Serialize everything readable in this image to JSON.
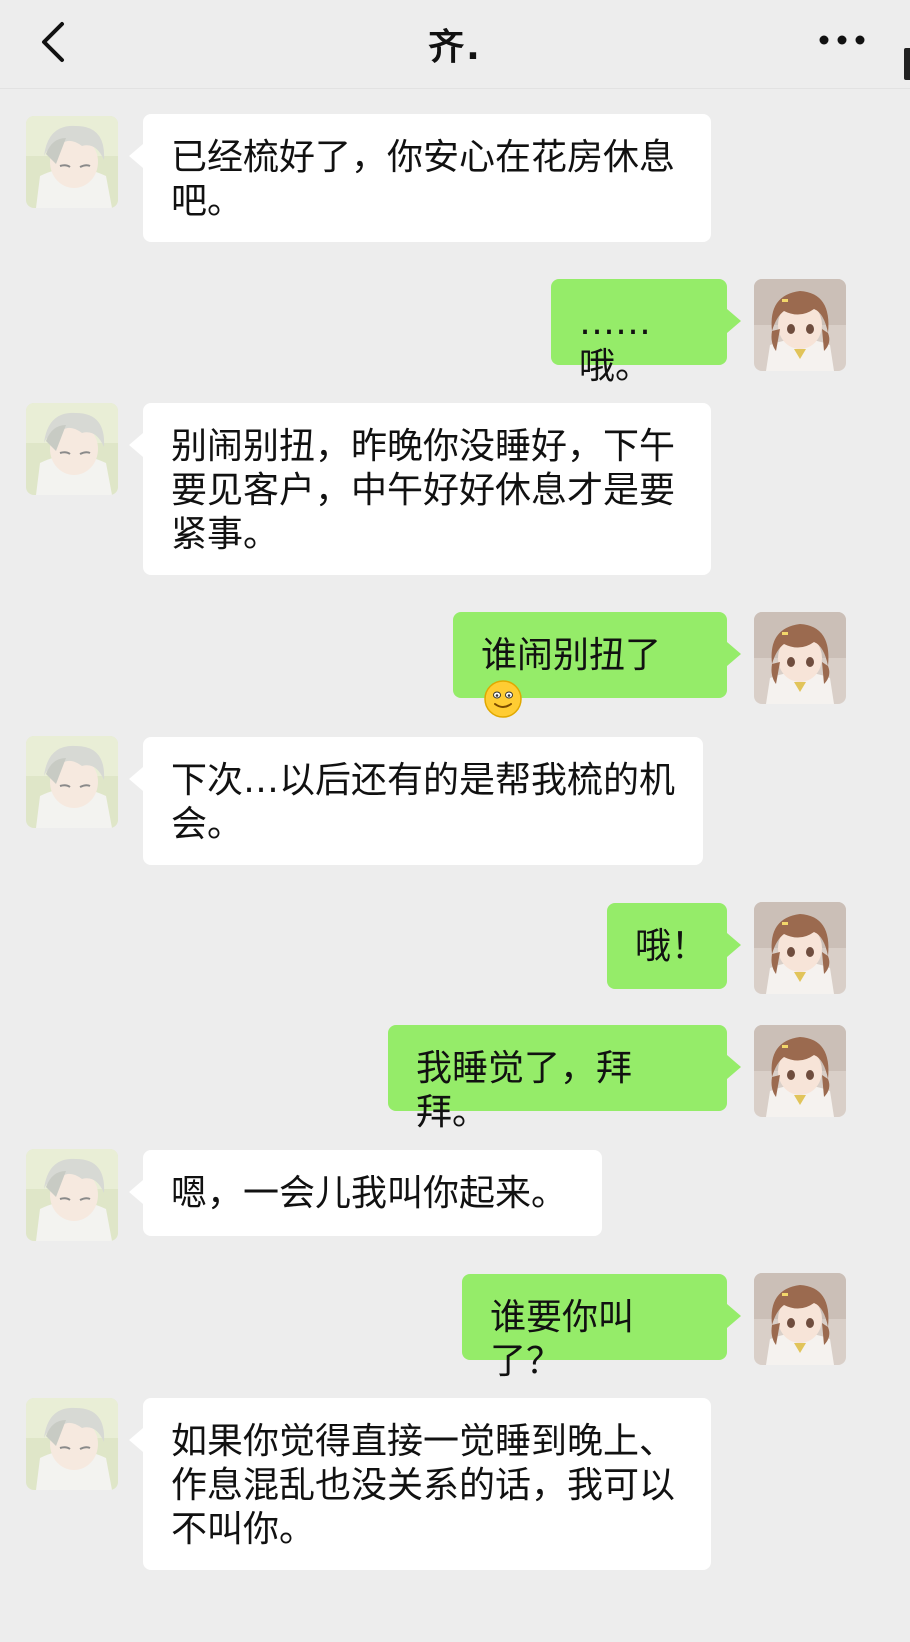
{
  "header": {
    "title": "齐."
  },
  "messages": [
    {
      "side": "in",
      "text": "已经梳好了，你安心在花房休息吧。"
    },
    {
      "side": "out",
      "text": "……哦。"
    },
    {
      "side": "in",
      "text": "别闹别扭，昨晚你没睡好，下午要见客户，中午好好休息才是要紧事。"
    },
    {
      "side": "out",
      "text": "谁闹别扭了",
      "emoji": "smiley-emoji"
    },
    {
      "side": "in",
      "text": "下次…以后还有的是帮我梳的机会。"
    },
    {
      "side": "out",
      "text": "哦！"
    },
    {
      "side": "out",
      "text": "我睡觉了，拜拜。"
    },
    {
      "side": "in",
      "text": "嗯，一会儿我叫你起来。"
    },
    {
      "side": "out",
      "text": "谁要你叫了？"
    },
    {
      "side": "in",
      "text": "如果你觉得直接一觉睡到晚上、作息混乱也没关系的话，我可以不叫你。"
    }
  ],
  "icons": {
    "back": "chevron-left-icon",
    "more": "more-dots-icon"
  },
  "colors": {
    "background": "#ededed",
    "incoming_bubble": "#ffffff",
    "outgoing_bubble": "#95ec69"
  }
}
